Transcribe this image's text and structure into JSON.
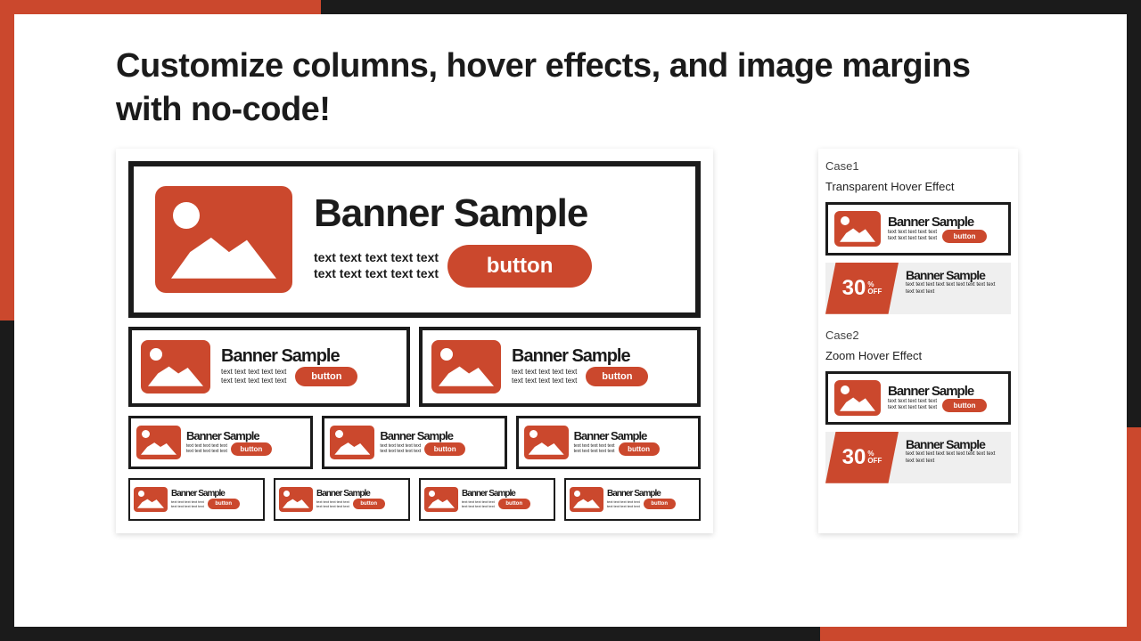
{
  "colors": {
    "accent": "#cb482d",
    "dark": "#1b1b1b"
  },
  "heading": "Customize columns, hover effects, and image margins with no-code!",
  "banner": {
    "title": "Banner Sample",
    "desc2": "text text text text text\ntext text text text text",
    "desc3": "text text text text text text text text text text text text",
    "button": "button"
  },
  "sale": {
    "number": "30",
    "unit_top": "%",
    "unit_bottom": "OFF",
    "title": "Banner Sample",
    "desc": "text text text text text text text text text text text text"
  },
  "cases": [
    {
      "label": "Case1",
      "caption": "Transparent Hover Effect"
    },
    {
      "label": "Case2",
      "caption": "Zoom Hover Effect"
    }
  ]
}
